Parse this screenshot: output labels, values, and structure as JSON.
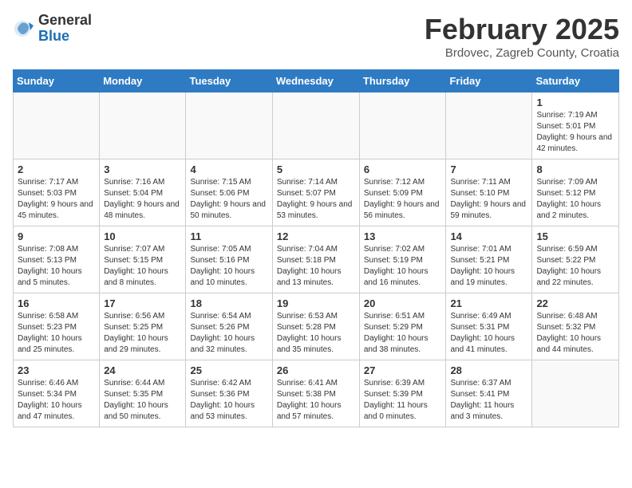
{
  "header": {
    "logo_general": "General",
    "logo_blue": "Blue",
    "month_title": "February 2025",
    "location": "Brdovec, Zagreb County, Croatia"
  },
  "days_of_week": [
    "Sunday",
    "Monday",
    "Tuesday",
    "Wednesday",
    "Thursday",
    "Friday",
    "Saturday"
  ],
  "weeks": [
    [
      {
        "day": "",
        "info": ""
      },
      {
        "day": "",
        "info": ""
      },
      {
        "day": "",
        "info": ""
      },
      {
        "day": "",
        "info": ""
      },
      {
        "day": "",
        "info": ""
      },
      {
        "day": "",
        "info": ""
      },
      {
        "day": "1",
        "info": "Sunrise: 7:19 AM\nSunset: 5:01 PM\nDaylight: 9 hours and 42 minutes."
      }
    ],
    [
      {
        "day": "2",
        "info": "Sunrise: 7:17 AM\nSunset: 5:03 PM\nDaylight: 9 hours and 45 minutes."
      },
      {
        "day": "3",
        "info": "Sunrise: 7:16 AM\nSunset: 5:04 PM\nDaylight: 9 hours and 48 minutes."
      },
      {
        "day": "4",
        "info": "Sunrise: 7:15 AM\nSunset: 5:06 PM\nDaylight: 9 hours and 50 minutes."
      },
      {
        "day": "5",
        "info": "Sunrise: 7:14 AM\nSunset: 5:07 PM\nDaylight: 9 hours and 53 minutes."
      },
      {
        "day": "6",
        "info": "Sunrise: 7:12 AM\nSunset: 5:09 PM\nDaylight: 9 hours and 56 minutes."
      },
      {
        "day": "7",
        "info": "Sunrise: 7:11 AM\nSunset: 5:10 PM\nDaylight: 9 hours and 59 minutes."
      },
      {
        "day": "8",
        "info": "Sunrise: 7:09 AM\nSunset: 5:12 PM\nDaylight: 10 hours and 2 minutes."
      }
    ],
    [
      {
        "day": "9",
        "info": "Sunrise: 7:08 AM\nSunset: 5:13 PM\nDaylight: 10 hours and 5 minutes."
      },
      {
        "day": "10",
        "info": "Sunrise: 7:07 AM\nSunset: 5:15 PM\nDaylight: 10 hours and 8 minutes."
      },
      {
        "day": "11",
        "info": "Sunrise: 7:05 AM\nSunset: 5:16 PM\nDaylight: 10 hours and 10 minutes."
      },
      {
        "day": "12",
        "info": "Sunrise: 7:04 AM\nSunset: 5:18 PM\nDaylight: 10 hours and 13 minutes."
      },
      {
        "day": "13",
        "info": "Sunrise: 7:02 AM\nSunset: 5:19 PM\nDaylight: 10 hours and 16 minutes."
      },
      {
        "day": "14",
        "info": "Sunrise: 7:01 AM\nSunset: 5:21 PM\nDaylight: 10 hours and 19 minutes."
      },
      {
        "day": "15",
        "info": "Sunrise: 6:59 AM\nSunset: 5:22 PM\nDaylight: 10 hours and 22 minutes."
      }
    ],
    [
      {
        "day": "16",
        "info": "Sunrise: 6:58 AM\nSunset: 5:23 PM\nDaylight: 10 hours and 25 minutes."
      },
      {
        "day": "17",
        "info": "Sunrise: 6:56 AM\nSunset: 5:25 PM\nDaylight: 10 hours and 29 minutes."
      },
      {
        "day": "18",
        "info": "Sunrise: 6:54 AM\nSunset: 5:26 PM\nDaylight: 10 hours and 32 minutes."
      },
      {
        "day": "19",
        "info": "Sunrise: 6:53 AM\nSunset: 5:28 PM\nDaylight: 10 hours and 35 minutes."
      },
      {
        "day": "20",
        "info": "Sunrise: 6:51 AM\nSunset: 5:29 PM\nDaylight: 10 hours and 38 minutes."
      },
      {
        "day": "21",
        "info": "Sunrise: 6:49 AM\nSunset: 5:31 PM\nDaylight: 10 hours and 41 minutes."
      },
      {
        "day": "22",
        "info": "Sunrise: 6:48 AM\nSunset: 5:32 PM\nDaylight: 10 hours and 44 minutes."
      }
    ],
    [
      {
        "day": "23",
        "info": "Sunrise: 6:46 AM\nSunset: 5:34 PM\nDaylight: 10 hours and 47 minutes."
      },
      {
        "day": "24",
        "info": "Sunrise: 6:44 AM\nSunset: 5:35 PM\nDaylight: 10 hours and 50 minutes."
      },
      {
        "day": "25",
        "info": "Sunrise: 6:42 AM\nSunset: 5:36 PM\nDaylight: 10 hours and 53 minutes."
      },
      {
        "day": "26",
        "info": "Sunrise: 6:41 AM\nSunset: 5:38 PM\nDaylight: 10 hours and 57 minutes."
      },
      {
        "day": "27",
        "info": "Sunrise: 6:39 AM\nSunset: 5:39 PM\nDaylight: 11 hours and 0 minutes."
      },
      {
        "day": "28",
        "info": "Sunrise: 6:37 AM\nSunset: 5:41 PM\nDaylight: 11 hours and 3 minutes."
      },
      {
        "day": "",
        "info": ""
      }
    ]
  ]
}
